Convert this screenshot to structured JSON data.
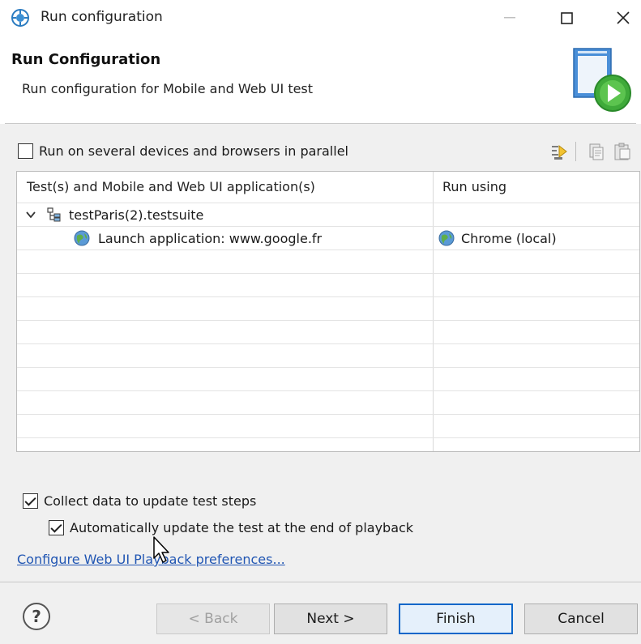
{
  "window": {
    "title": "Run configuration",
    "controls": {
      "minimize": "—",
      "maximize": "☐",
      "close": "✕"
    }
  },
  "header": {
    "title": "Run Configuration",
    "description": "Run configuration for Mobile and Web UI test"
  },
  "options": {
    "parallel": {
      "label": "Run on several devices and browsers in parallel",
      "checked": false
    },
    "collect_data": {
      "label": "Collect data to update test steps",
      "checked": true
    },
    "auto_update": {
      "label": "Automatically update the test at the end of playback",
      "checked": true
    }
  },
  "toolbar": {
    "icons": [
      "assign-icon",
      "copy-settings-icon",
      "paste-settings-icon"
    ]
  },
  "table": {
    "columns": [
      "Test(s) and Mobile and Web UI application(s)",
      "Run using"
    ],
    "rows": [
      {
        "label": "testParis(2).testsuite",
        "run_using": "",
        "icon": "test-suite-icon",
        "expanded": true
      },
      {
        "label": "Launch application: www.google.fr",
        "run_using": "Chrome (local)",
        "icon": "globe-icon"
      }
    ]
  },
  "link": "Configure Web UI Playback preferences...",
  "footer": {
    "help": "?",
    "back": "< Back",
    "next": "Next >",
    "finish": "Finish",
    "cancel": "Cancel"
  },
  "colors": {
    "link": "#2156b3",
    "default_button_border": "#0a66c9",
    "dialog_bg": "#f0f0f0"
  }
}
